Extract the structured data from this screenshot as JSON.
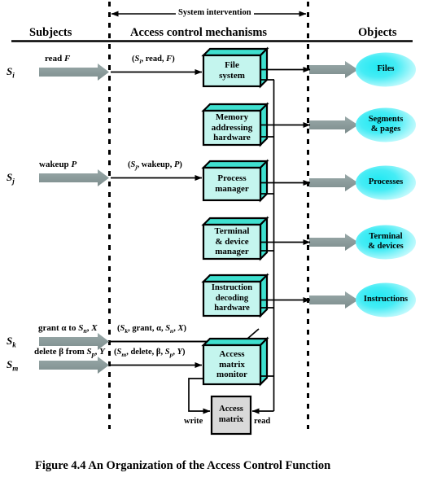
{
  "figure": {
    "caption": "Figure 4.4  An Organization of the Access Control Function",
    "system_intervention_label": "System intervention"
  },
  "columns": {
    "subjects": "Subjects",
    "mechanisms": "Access control mechanisms",
    "objects": "Objects"
  },
  "subjects": [
    {
      "name": "S",
      "sub": "i",
      "request": "read F",
      "request_italic": "F",
      "tuple": "(Si, read, F)"
    },
    {
      "name": "S",
      "sub": "j",
      "request": "wakeup P",
      "request_italic": "P",
      "tuple": "(Sj, wakeup, P)"
    },
    {
      "name": "S",
      "sub": "k",
      "request": "grant α to Sn, X",
      "request_italic": "X",
      "tuple": "(Sk, grant, α, Sn, X)"
    },
    {
      "name": "S",
      "sub": "m",
      "request": "delete β from Sp, Y",
      "request_italic": "Y",
      "tuple": "(Sm, delete, β, Sp, Y)"
    }
  ],
  "mechanisms": [
    {
      "label": "File system",
      "lines": [
        "File",
        "system"
      ]
    },
    {
      "label": "Memory addressing hardware",
      "lines": [
        "Memory",
        "addressing",
        "hardware"
      ]
    },
    {
      "label": "Process manager",
      "lines": [
        "Process",
        "manager"
      ]
    },
    {
      "label": "Terminal & device manager",
      "lines": [
        "Terminal",
        "& device",
        "manager"
      ]
    },
    {
      "label": "Instruction decoding hardware",
      "lines": [
        "Instruction",
        "decoding",
        "hardware"
      ]
    },
    {
      "label": "Access matrix monitor",
      "lines": [
        "Access",
        "matrix",
        "monitor"
      ]
    }
  ],
  "objects": [
    {
      "label": "Files",
      "lines": [
        "Files"
      ]
    },
    {
      "label": "Segments & pages",
      "lines": [
        "Segments",
        "& pages"
      ]
    },
    {
      "label": "Processes",
      "lines": [
        "Processes"
      ]
    },
    {
      "label": "Terminal & devices",
      "lines": [
        "Terminal",
        "& devices"
      ]
    },
    {
      "label": "Instructions",
      "lines": [
        "Instructions"
      ]
    }
  ],
  "access_matrix": {
    "lines": [
      "Access",
      "matrix"
    ],
    "write_label": "write",
    "read_label": "read"
  },
  "colors": {
    "box_face": "#c4f5ee",
    "box_top": "#3fe0cf",
    "box_side": "#3fe0cf",
    "ellipse_core": "#28e8f0",
    "ellipse_edge": "#c9fbff",
    "matrix_fill": "#d9d9d9",
    "subject_arrow": "#8a9a9a",
    "object_arrow": "#8a9a9a",
    "line": "#000000"
  }
}
